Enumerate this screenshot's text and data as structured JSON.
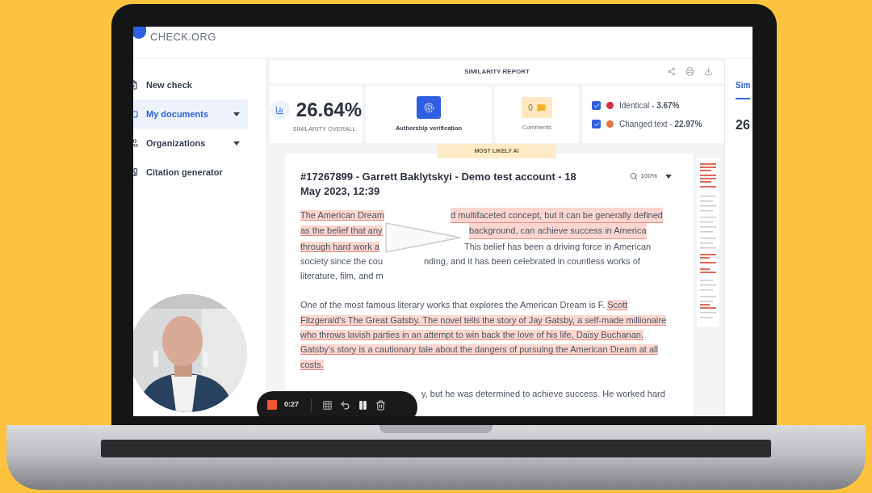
{
  "app": {
    "logo_text": "CHECK.ORG"
  },
  "sidebar": {
    "items": [
      {
        "label": "New check",
        "selected": false,
        "expandable": false
      },
      {
        "label": "My documents",
        "selected": true,
        "expandable": true
      },
      {
        "label": "Organizations",
        "selected": false,
        "expandable": true
      },
      {
        "label": "Citation generator",
        "selected": false,
        "expandable": false
      }
    ]
  },
  "report": {
    "title": "SIMILARITY REPORT",
    "score": "26.64%",
    "score_label": "SIMILARITY OVERALL",
    "authorship_label": "Authorship verification",
    "comments_count": "0",
    "comments_label": "Comments",
    "filters": [
      {
        "label": "Identical - **3.67%**",
        "checked": true,
        "color": "#d9304a"
      },
      {
        "label": "Changed text - **22.97%**",
        "checked": true,
        "color": "#e8734a"
      }
    ],
    "ai_badge": "MOST LIKELY AI"
  },
  "document": {
    "title": "#17267899 - Garrett Baklytskyi - Demo test account - 18 May 2023, 12:39",
    "zoom": "100%",
    "occluded_lines": [
      {
        "left": "The American Dream",
        "right": "d multifaceted concept, but it can be generally defined",
        "left_highlighted": true,
        "right_highlighted": true
      },
      {
        "left": "as the belief that any",
        "right": "background, can achieve success in America",
        "left_highlighted": true,
        "right_highlighted": true
      },
      {
        "left": "through hard work a",
        "right": "This belief has been a driving force in American",
        "left_highlighted": true,
        "right_highlighted": false
      },
      {
        "left": "society since the cou",
        "right": "nding, and it has been celebrated in countless works of",
        "left_highlighted": false,
        "right_highlighted": false
      },
      {
        "left": "literature, film, and m",
        "left_highlighted": false
      }
    ],
    "paragraph": [
      {
        "text": "One of the most famous literary works that explores the American Dream is F. ",
        "highlighted": false
      },
      {
        "text": "Scott Fitzgerald's The Great Gatsby. The novel tells the story of Jay Gatsby, a self-made millionaire who throws lavish parties in an attempt to win back the love of his life, Daisy Buchanan. Gatsby's story is a cautionary tale about the dangers of pursuing the American Dream at all costs.",
        "highlighted": true
      }
    ],
    "partial_line": "y, but he was determined to achieve success. He worked hard"
  },
  "side_panel": {
    "tab": "Sim",
    "score": "26"
  },
  "recorder": {
    "time": "0:27"
  }
}
